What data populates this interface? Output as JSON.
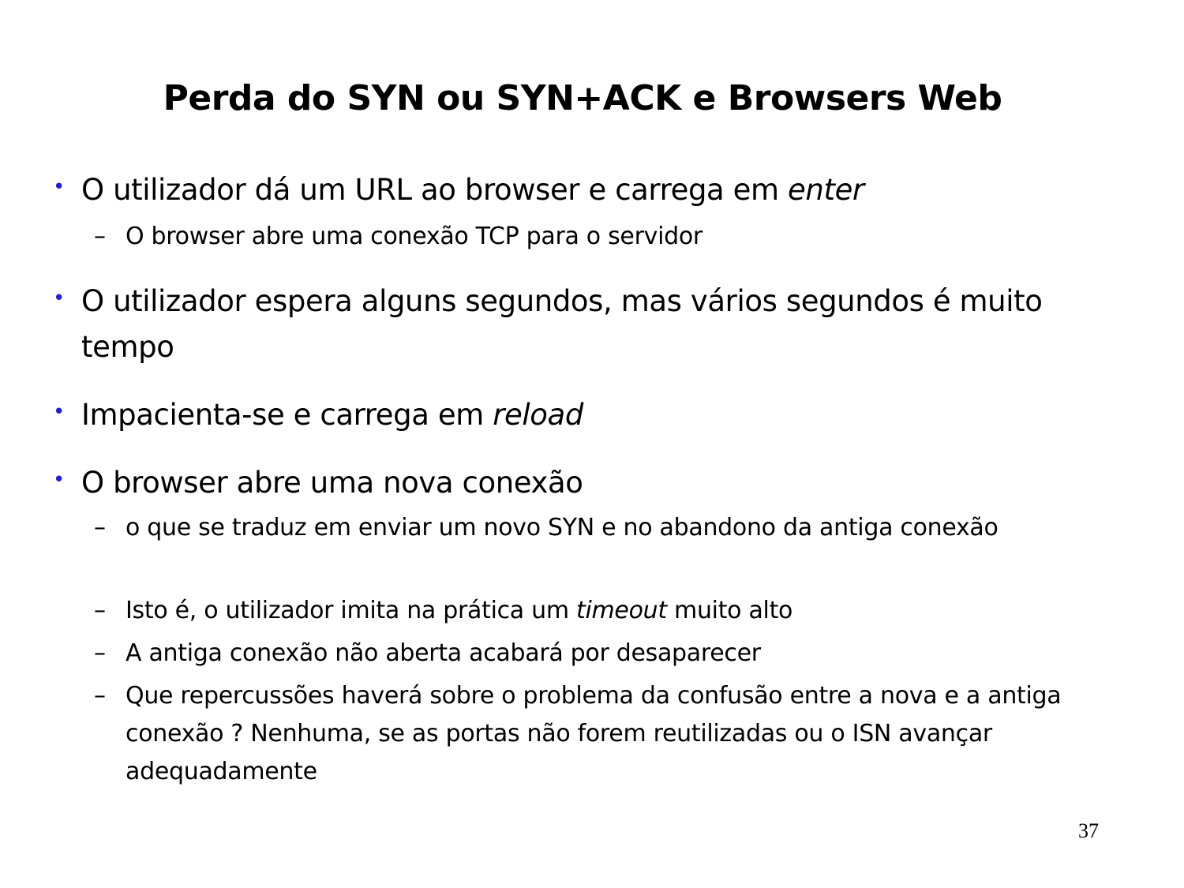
{
  "slide": {
    "title": "Perda do SYN ou SYN+ACK e Browsers Web",
    "page_number": "37",
    "bullet_color": "#2222cc",
    "bullet_symbol": "•",
    "dash_symbol": "–",
    "items": [
      {
        "text": "O utilizador dá um URL ao browser e carrega em ",
        "emphasis": "enter",
        "subitems": [
          {
            "text": "O browser abre uma conexão TCP para o servidor"
          }
        ]
      },
      {
        "text": "O utilizador espera alguns segundos, mas vários segundos é muito tempo"
      },
      {
        "text": "Impacienta-se e carrega em ",
        "emphasis": "reload"
      },
      {
        "text": "O browser abre uma nova conexão",
        "subitems": [
          {
            "text": "o que se traduz em enviar um novo SYN e no abandono da antiga conexão"
          },
          {
            "text_before": "Isto é, o utilizador imita na prática um ",
            "emphasis": "timeout",
            "text_after": " muito alto"
          },
          {
            "text": "A antiga conexão não aberta acabará por desaparecer"
          },
          {
            "text": "Que repercussões haverá sobre o problema da confusão entre a nova e a antiga conexão ? Nenhuma, se as portas não forem reutilizadas ou o ISN avançar adequadamente"
          }
        ]
      }
    ]
  }
}
